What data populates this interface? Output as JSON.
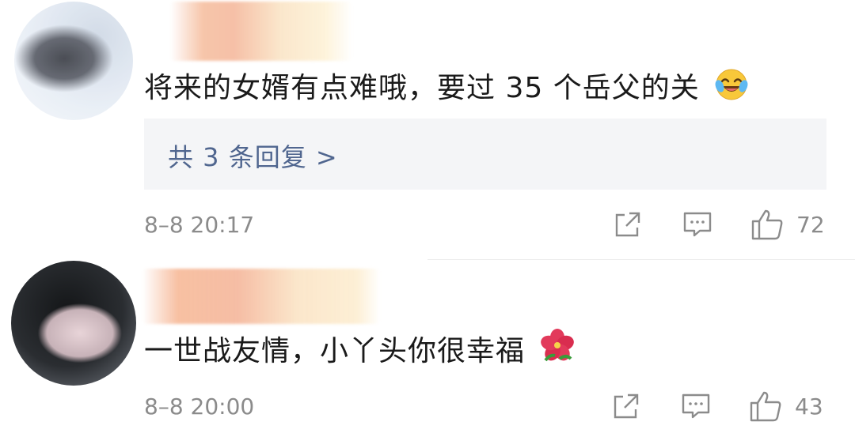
{
  "comments": [
    {
      "text": "将来的女婿有点难哦，要过 35 个岳父的关",
      "emoji": "laughing-crying",
      "replies_label": "共 3 条回复 >",
      "time": "8–8 20:17",
      "likes": "72"
    },
    {
      "text": "一世战友情，小丫头你很幸福",
      "emoji": "hibiscus-flower",
      "time": "8–8 20:00",
      "likes": "43"
    }
  ],
  "colors": {
    "link": "#50668f",
    "meta": "#8b8b8b",
    "reply_bg": "#f4f5f7"
  }
}
